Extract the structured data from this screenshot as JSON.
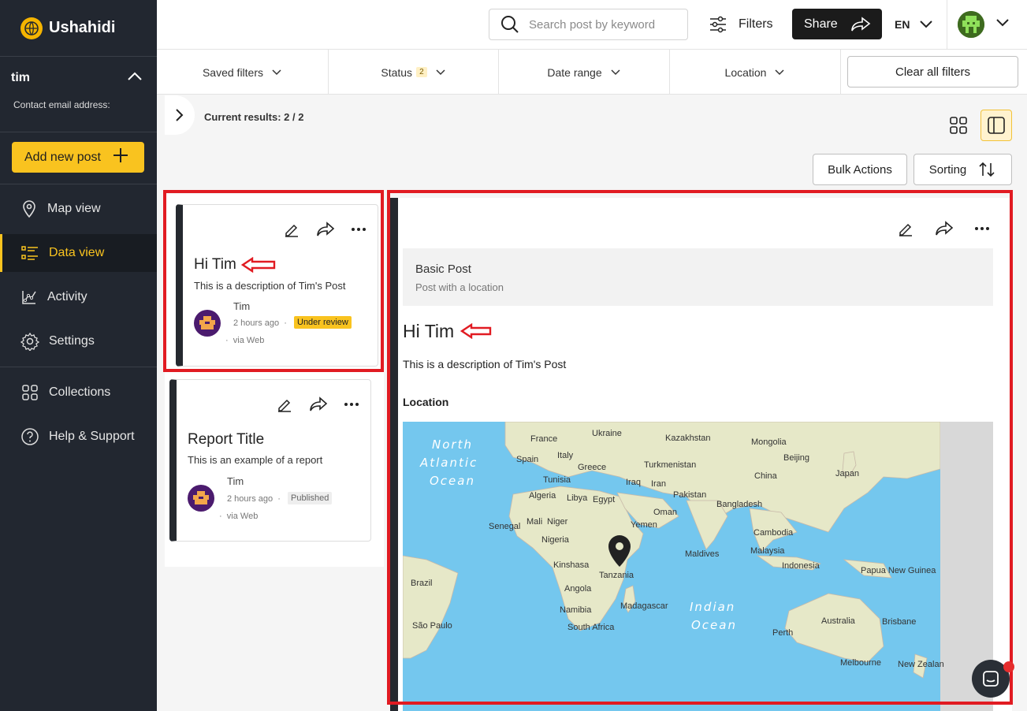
{
  "app": {
    "name": "Ushahidi"
  },
  "user": {
    "name": "tim",
    "contact_label": "Contact email address:"
  },
  "sidebar": {
    "add_post": "Add new post",
    "nav": [
      {
        "label": "Map view",
        "icon": "map-pin-icon"
      },
      {
        "label": "Data view",
        "icon": "list-icon"
      },
      {
        "label": "Activity",
        "icon": "activity-icon"
      },
      {
        "label": "Settings",
        "icon": "gear-icon"
      },
      {
        "label": "Collections",
        "icon": "collections-icon"
      },
      {
        "label": "Help & Support",
        "icon": "help-icon"
      }
    ],
    "active": "Data view"
  },
  "topbar": {
    "search_placeholder": "Search post by keyword",
    "filters_label": "Filters",
    "share_label": "Share",
    "language": "EN"
  },
  "filterbar": {
    "saved_filters": "Saved filters",
    "status": "Status",
    "status_count": "2",
    "date_range": "Date range",
    "location": "Location",
    "clear_all": "Clear all filters"
  },
  "results": {
    "label": "Current results: 2 / 2"
  },
  "actions": {
    "bulk": "Bulk Actions",
    "sorting": "Sorting"
  },
  "posts": [
    {
      "title": "Hi Tim",
      "description": "This is a description of Tim's Post",
      "author": "Tim",
      "time": "2 hours ago",
      "status": "Under review",
      "via": "via Web"
    },
    {
      "title": "Report Title",
      "description": "This is an example of a report",
      "author": "Tim",
      "time": "2 hours ago",
      "status": "Published",
      "via": "via Web"
    }
  ],
  "detail": {
    "survey_name": "Basic Post",
    "survey_description": "Post with a location",
    "title": "Hi Tim",
    "description": "This is a description of Tim's Post",
    "location_label": "Location"
  },
  "map": {
    "ocean_labels": {
      "north_atlantic": [
        "North",
        "Atlantic",
        "Ocean"
      ],
      "indian": [
        "Indian",
        "Ocean"
      ]
    },
    "places": [
      "France",
      "Ukraine",
      "Kazakhstan",
      "Mongolia",
      "Spain",
      "Italy",
      "Greece",
      "Turkmenistan",
      "Beijing",
      "China",
      "Japan",
      "Tunisia",
      "Iraq",
      "Iran",
      "Algeria",
      "Libya",
      "Egypt",
      "Pakistan",
      "Bangladesh",
      "Oman",
      "Senegal",
      "Mali",
      "Niger",
      "Yemen",
      "Cambodia",
      "Nigeria",
      "Malaysia",
      "Maldives",
      "Kinshasa",
      "Tanzania",
      "Indonesia",
      "Papua New Guinea",
      "Angola",
      "Brazil",
      "Namibia",
      "Madagascar",
      "South Africa",
      "São Paulo",
      "Australia",
      "Brisbane",
      "Perth",
      "Melbourne",
      "New Zealan"
    ]
  },
  "colors": {
    "accent": "#f9c31f",
    "sidebar_bg": "#222730",
    "highlight": "#e11b22",
    "ocean": "#74c7ee",
    "land": "#e6e8c8"
  }
}
